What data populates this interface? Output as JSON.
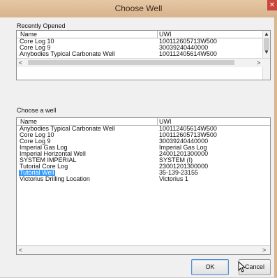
{
  "window": {
    "title": "Choose Well",
    "close_icon": "x-icon"
  },
  "recently_opened": {
    "label": "Recently Opened",
    "columns": {
      "name": "Name",
      "uwi": "UWI"
    },
    "rows": [
      {
        "name": "Core Log 10",
        "uwi": "100112605713W500"
      },
      {
        "name": "Core Log 9",
        "uwi": "30039240440000"
      },
      {
        "name": "Anybodies Typical Carbonate Well",
        "uwi": "100112405614W500"
      }
    ]
  },
  "choose_well": {
    "label": "Choose a well",
    "columns": {
      "name": "Name",
      "uwi": "UWI"
    },
    "selected_index": 6,
    "rows": [
      {
        "name": "Anybodies Typical Carbonate Well",
        "uwi": "100112405614W500"
      },
      {
        "name": "Core Log 10",
        "uwi": "100112605713W500"
      },
      {
        "name": "Core Log 9",
        "uwi": "30039240440000"
      },
      {
        "name": "Imperial Gas Log",
        "uwi": "Imperial Gas Log"
      },
      {
        "name": "Imperial Horizontal Well",
        "uwi": "24001201300000"
      },
      {
        "name": "SYSTEM IMPERIAL",
        "uwi": "SYSTEM (I)"
      },
      {
        "name": "Tutorial Core Log",
        "uwi": "23001201300000"
      },
      {
        "name": "Tutorial Well",
        "uwi": "35-139-23155"
      },
      {
        "name": "Victorius Drilling Location",
        "uwi": "Victorius 1"
      }
    ]
  },
  "buttons": {
    "ok": "OK",
    "cancel": "Cancel"
  },
  "colors": {
    "selection": "#3399ff",
    "titlebar": "#dcb894",
    "close": "#c9473c"
  }
}
